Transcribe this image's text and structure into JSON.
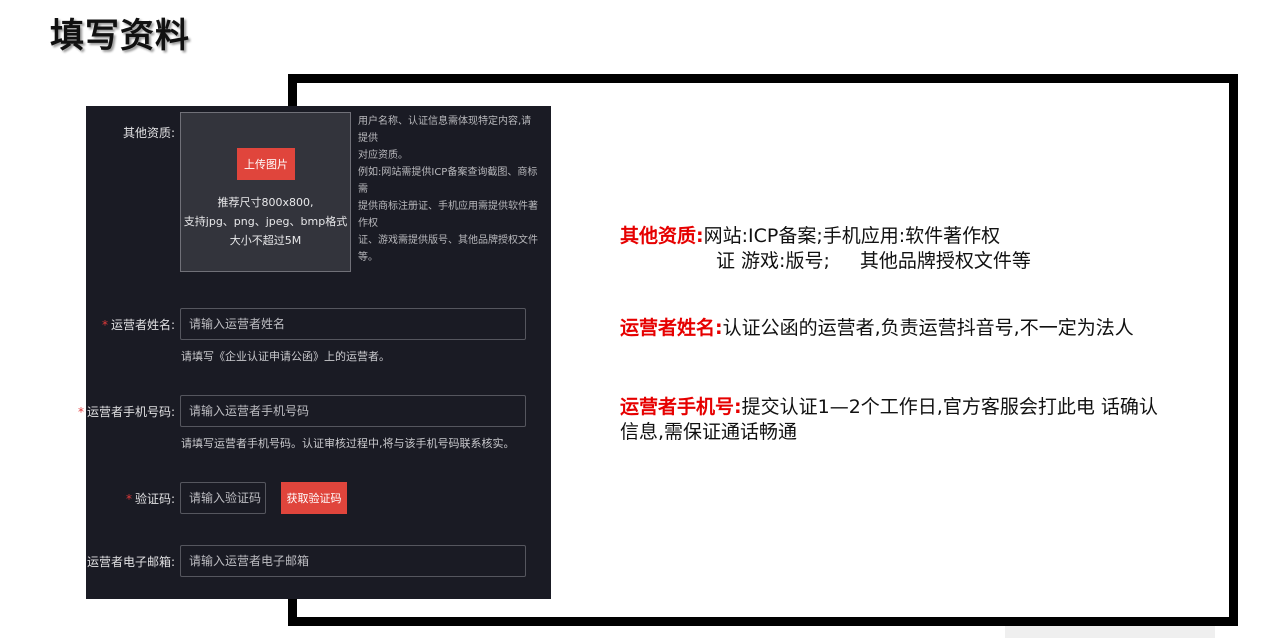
{
  "page": {
    "title": "填写资料"
  },
  "form": {
    "qualification": {
      "label": "其他资质:",
      "upload_button": "上传图片",
      "hint_lines": [
        "推荐尺寸800x800,",
        "支持jpg、png、jpeg、bmp格式",
        "大小不超过5M"
      ],
      "side_note_lines": [
        "用户名称、认证信息需体现特定内容,请提供",
        "对应资质。",
        "例如:网站需提供ICP备案查询截图、商标需",
        "提供商标注册证、手机应用需提供软件著作权",
        "证、游戏需提供版号、其他品牌授权文件等。"
      ]
    },
    "operator_name": {
      "required_mark": "*",
      "label": "运营者姓名:",
      "placeholder": "请输入运营者姓名",
      "help": "请填写《企业认证申请公函》上的运营者。"
    },
    "operator_phone": {
      "required_mark": "*",
      "label": "运营者手机号码:",
      "placeholder": "请输入运营者手机号码",
      "help": "请填写运营者手机号码。认证审核过程中,将与该手机号码联系核实。"
    },
    "verify_code": {
      "required_mark": "*",
      "label": "验证码:",
      "placeholder": "请输入验证码",
      "button": "获取验证码"
    },
    "operator_email": {
      "label": "运营者电子邮箱:",
      "placeholder": "请输入运营者电子邮箱"
    }
  },
  "notes": {
    "qualification": {
      "key": "其他资质",
      "colon": ":",
      "line1": "网站:ICP备案;手机应用:软件著作权",
      "line2a": "证 游戏:版号;",
      "line2b": "其他品牌授权文件等"
    },
    "operator_name": {
      "key": "运营者姓名",
      "colon": ":",
      "text": "认证公函的运营者,负责运营抖音号,不一定为法人"
    },
    "operator_phone": {
      "key": "运营者手机号",
      "colon": ":",
      "text": "提交认证1—2个工作日,官方客服会打此电 话确认信息,需保证通话畅通"
    }
  },
  "colors": {
    "panel_bg": "#1a1b24",
    "accent_red": "#e0453c",
    "note_key_red": "#e60000",
    "frame_border": "#000000"
  }
}
